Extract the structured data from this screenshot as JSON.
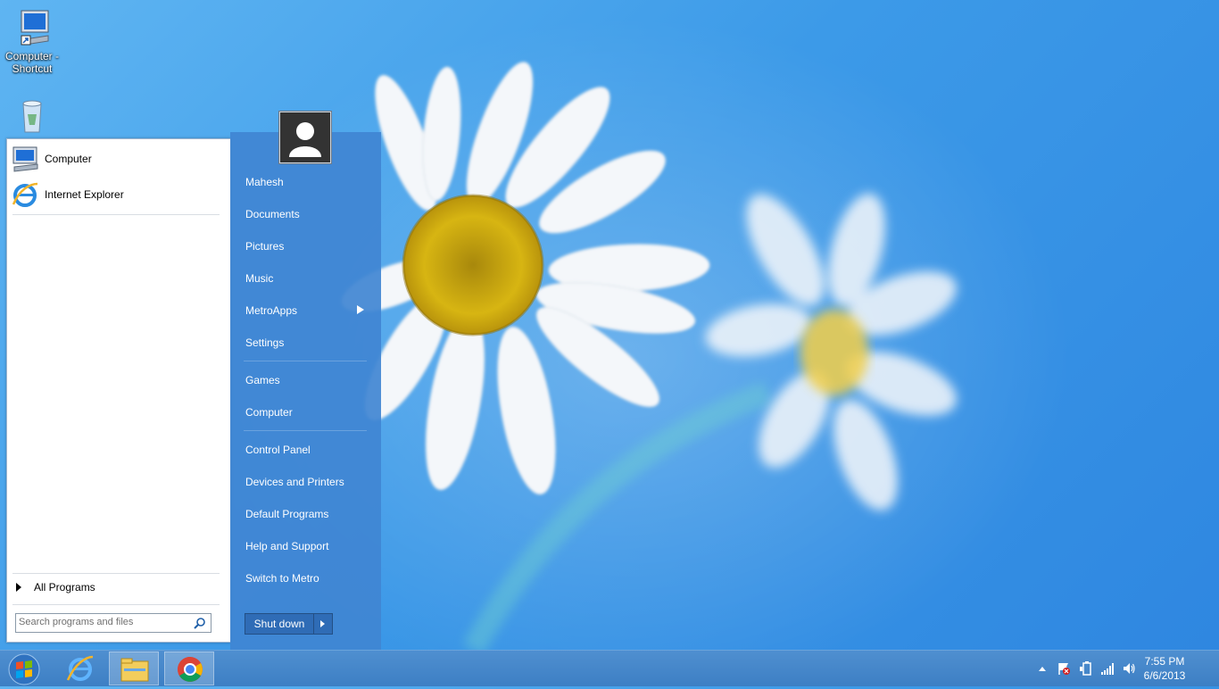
{
  "desktop": {
    "icons": [
      {
        "label": "Computer - Shortcut",
        "icon": "computer-shortcut-icon"
      },
      {
        "label": "",
        "icon": "recycle-bin-icon"
      }
    ]
  },
  "start_menu": {
    "pinned": [
      {
        "label": "Computer",
        "icon": "computer-icon"
      },
      {
        "label": "Internet Explorer",
        "icon": "internet-explorer-icon"
      }
    ],
    "all_programs": "All Programs",
    "search_placeholder": "Search programs and files",
    "user": "Mahesh",
    "places": [
      "Documents",
      "Pictures",
      "Music",
      "MetroApps",
      "Settings",
      "Games",
      "Computer",
      "Control Panel",
      "Devices and Printers",
      "Default Programs",
      "Help and Support",
      "Switch to Metro"
    ],
    "shutdown": "Shut down"
  },
  "taskbar": {
    "pinned": [
      "start-orb-icon",
      "internet-explorer-icon",
      "file-explorer-icon",
      "chrome-icon"
    ],
    "clock": {
      "time": "7:55 PM",
      "date": "6/6/2013"
    }
  },
  "colors": {
    "menu_blue": "#4085d2",
    "taskbar": "#4584c8"
  }
}
